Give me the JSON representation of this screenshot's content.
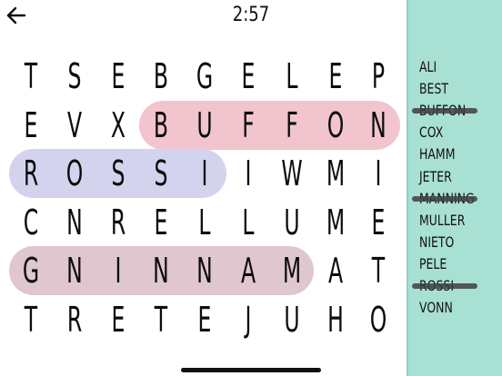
{
  "header": {
    "timer": "2:57"
  },
  "grid": {
    "rows": [
      [
        "T",
        "S",
        "E",
        "B",
        "G",
        "E",
        "L",
        "E",
        "P"
      ],
      [
        "E",
        "V",
        "X",
        "B",
        "U",
        "F",
        "F",
        "O",
        "N"
      ],
      [
        "R",
        "O",
        "S",
        "S",
        "I",
        "I",
        "W",
        "M",
        "I"
      ],
      [
        "C",
        "N",
        "R",
        "E",
        "L",
        "L",
        "U",
        "M",
        "E"
      ],
      [
        "G",
        "N",
        "I",
        "N",
        "N",
        "A",
        "M",
        "A",
        "T"
      ],
      [
        "T",
        "R",
        "E",
        "T",
        "E",
        "J",
        "U",
        "H",
        "O"
      ]
    ]
  },
  "found": [
    {
      "word": "BUFFON",
      "row": 1,
      "col_start": 3,
      "col_end": 8,
      "color": "#f2c4cd"
    },
    {
      "word": "ROSSI",
      "row": 2,
      "col_start": 0,
      "col_end": 4,
      "color": "#d4d3ee"
    },
    {
      "word": "MANNING",
      "row": 4,
      "col_start": 0,
      "col_end": 6,
      "color": "#dfc6cf"
    }
  ],
  "word_list": [
    {
      "text": "ALI",
      "found": false
    },
    {
      "text": "BEST",
      "found": false
    },
    {
      "text": "BUFFON",
      "found": true
    },
    {
      "text": "COX",
      "found": false
    },
    {
      "text": "HAMM",
      "found": false
    },
    {
      "text": "JETER",
      "found": false
    },
    {
      "text": "MANNING",
      "found": true
    },
    {
      "text": "MULLER",
      "found": false
    },
    {
      "text": "NIETO",
      "found": false
    },
    {
      "text": "PELE",
      "found": false
    },
    {
      "text": "ROSSI",
      "found": true
    },
    {
      "text": "VONN",
      "found": false
    }
  ],
  "colors": {
    "sidebar_bg": "#a8e0d3",
    "text": "#111111"
  },
  "icons": {
    "back": "arrow-left-icon"
  }
}
